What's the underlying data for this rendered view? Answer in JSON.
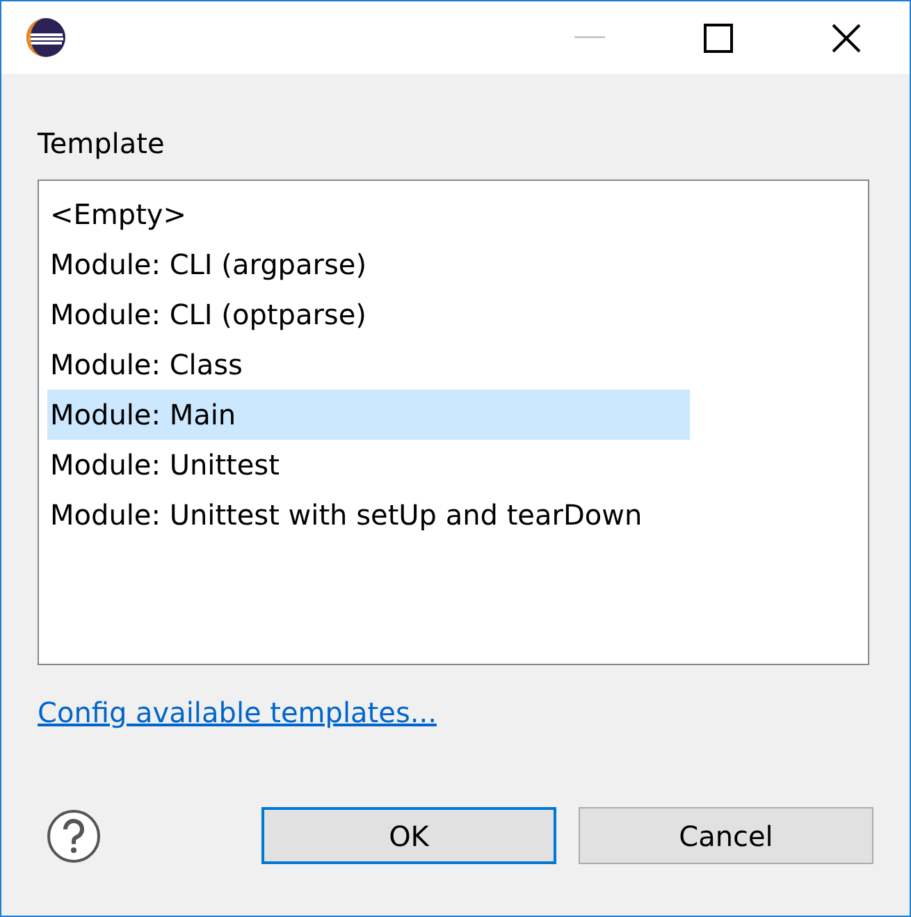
{
  "window": {
    "controls": [
      {
        "kind": "minimize",
        "disabled": true
      },
      {
        "kind": "maximize",
        "disabled": false
      },
      {
        "kind": "close",
        "disabled": false
      }
    ]
  },
  "template": {
    "label": "Template",
    "items": [
      {
        "text": "<Empty>",
        "selected": false
      },
      {
        "text": "Module: CLI (argparse)",
        "selected": false
      },
      {
        "text": "Module: CLI (optparse)",
        "selected": false
      },
      {
        "text": "Module: Class",
        "selected": false
      },
      {
        "text": "Module: Main",
        "selected": true
      },
      {
        "text": "Module: Unittest",
        "selected": false
      },
      {
        "text": "Module: Unittest with setUp and tearDown",
        "selected": false
      }
    ]
  },
  "link": "Config available templates...",
  "buttons": [
    {
      "label": "OK",
      "default": true
    },
    {
      "label": "Cancel",
      "default": false
    }
  ]
}
